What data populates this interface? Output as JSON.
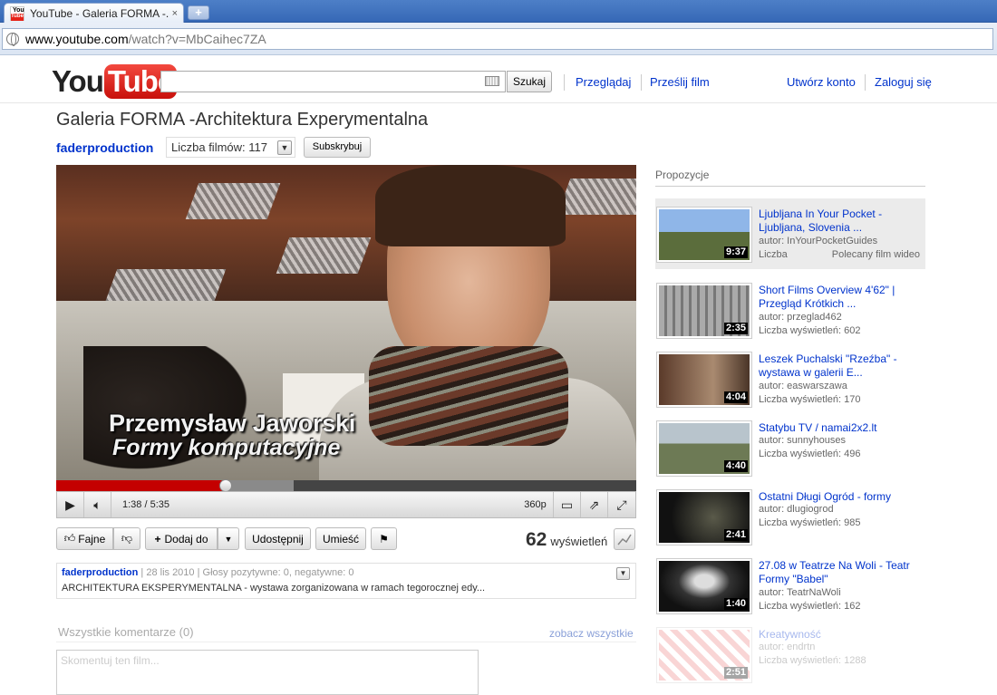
{
  "browser": {
    "tab_title": "YouTube - Galeria FORMA -...",
    "tab_close": "×",
    "newtab_label": "+",
    "url_domain": "www.youtube.com",
    "url_path": "/watch?v=MbCaihec7ZA"
  },
  "header": {
    "logo_you": "You",
    "logo_tube": "Tube",
    "search_button": "Szukaj",
    "nav_browse": "Przeglądaj",
    "nav_upload": "Prześlij film",
    "create_account": "Utwórz konto",
    "sign_in": "Zaloguj się"
  },
  "video": {
    "title": "Galeria FORMA -Architektura Experymentalna",
    "channel": "faderproduction",
    "video_count": "Liczba filmów: 117",
    "subscribe": "Subskrybuj",
    "caption_name": "Przemysław Jaworski",
    "caption_role": "Formy komputacyjne",
    "time": "1:38 / 5:35",
    "quality": "360p",
    "progress_fraction": 0.292,
    "buffered_fraction": 0.41
  },
  "actions": {
    "like": "Fajne",
    "add_to": "Dodaj do",
    "share": "Udostępnij",
    "embed": "Umieść",
    "views_count": "62",
    "views_label": "wyświetleń"
  },
  "info": {
    "channel": "faderproduction",
    "date": "28 lis 2010",
    "ratings": "Głosy pozytywne: 0, negatywne: 0",
    "description": "ARCHITEKTURA EKSPERYMENTALNA - wystawa zorganizowana w ramach tegorocznej edy..."
  },
  "comments": {
    "title": "Wszystkie komentarze (0)",
    "see_all": "zobacz wszystkie",
    "placeholder": "Skomentuj ten film..."
  },
  "sidebar": {
    "title": "Propozycje",
    "items": [
      {
        "title": "Ljubljana In Your Pocket - Ljubljana, Slovenia ...",
        "author": "autor: InYourPocketGuides",
        "views": "Liczba",
        "extra": "Polecany film wideo",
        "duration": "9:37"
      },
      {
        "title": "Short Films Overview 4'62\" | Przegląd Krótkich ...",
        "author": "autor: przeglad462",
        "views": "Liczba wyświetleń: 602",
        "duration": "2:35"
      },
      {
        "title": "Leszek Puchalski \"Rzeźba\" - wystawa w galerii E...",
        "author": "autor: easwarszawa",
        "views": "Liczba wyświetleń: 170",
        "duration": "4:04"
      },
      {
        "title": "Statybu TV / namai2x2.lt",
        "author": "autor: sunnyhouses",
        "views": "Liczba wyświetleń: 496",
        "duration": "4:40"
      },
      {
        "title": "Ostatni Długi Ogród - formy",
        "author": "autor: dlugiogrod",
        "views": "Liczba wyświetleń: 985",
        "duration": "2:41"
      },
      {
        "title": "27.08 w Teatrze Na Woli - Teatr Formy \"Babel\"",
        "author": "autor: TeatrNaWoli",
        "views": "Liczba wyświetleń: 162",
        "duration": "1:40"
      },
      {
        "title": "Kreatywność",
        "author": "autor: endrtn",
        "views": "Liczba wyświetleń: 1288",
        "duration": "2:51"
      }
    ]
  }
}
